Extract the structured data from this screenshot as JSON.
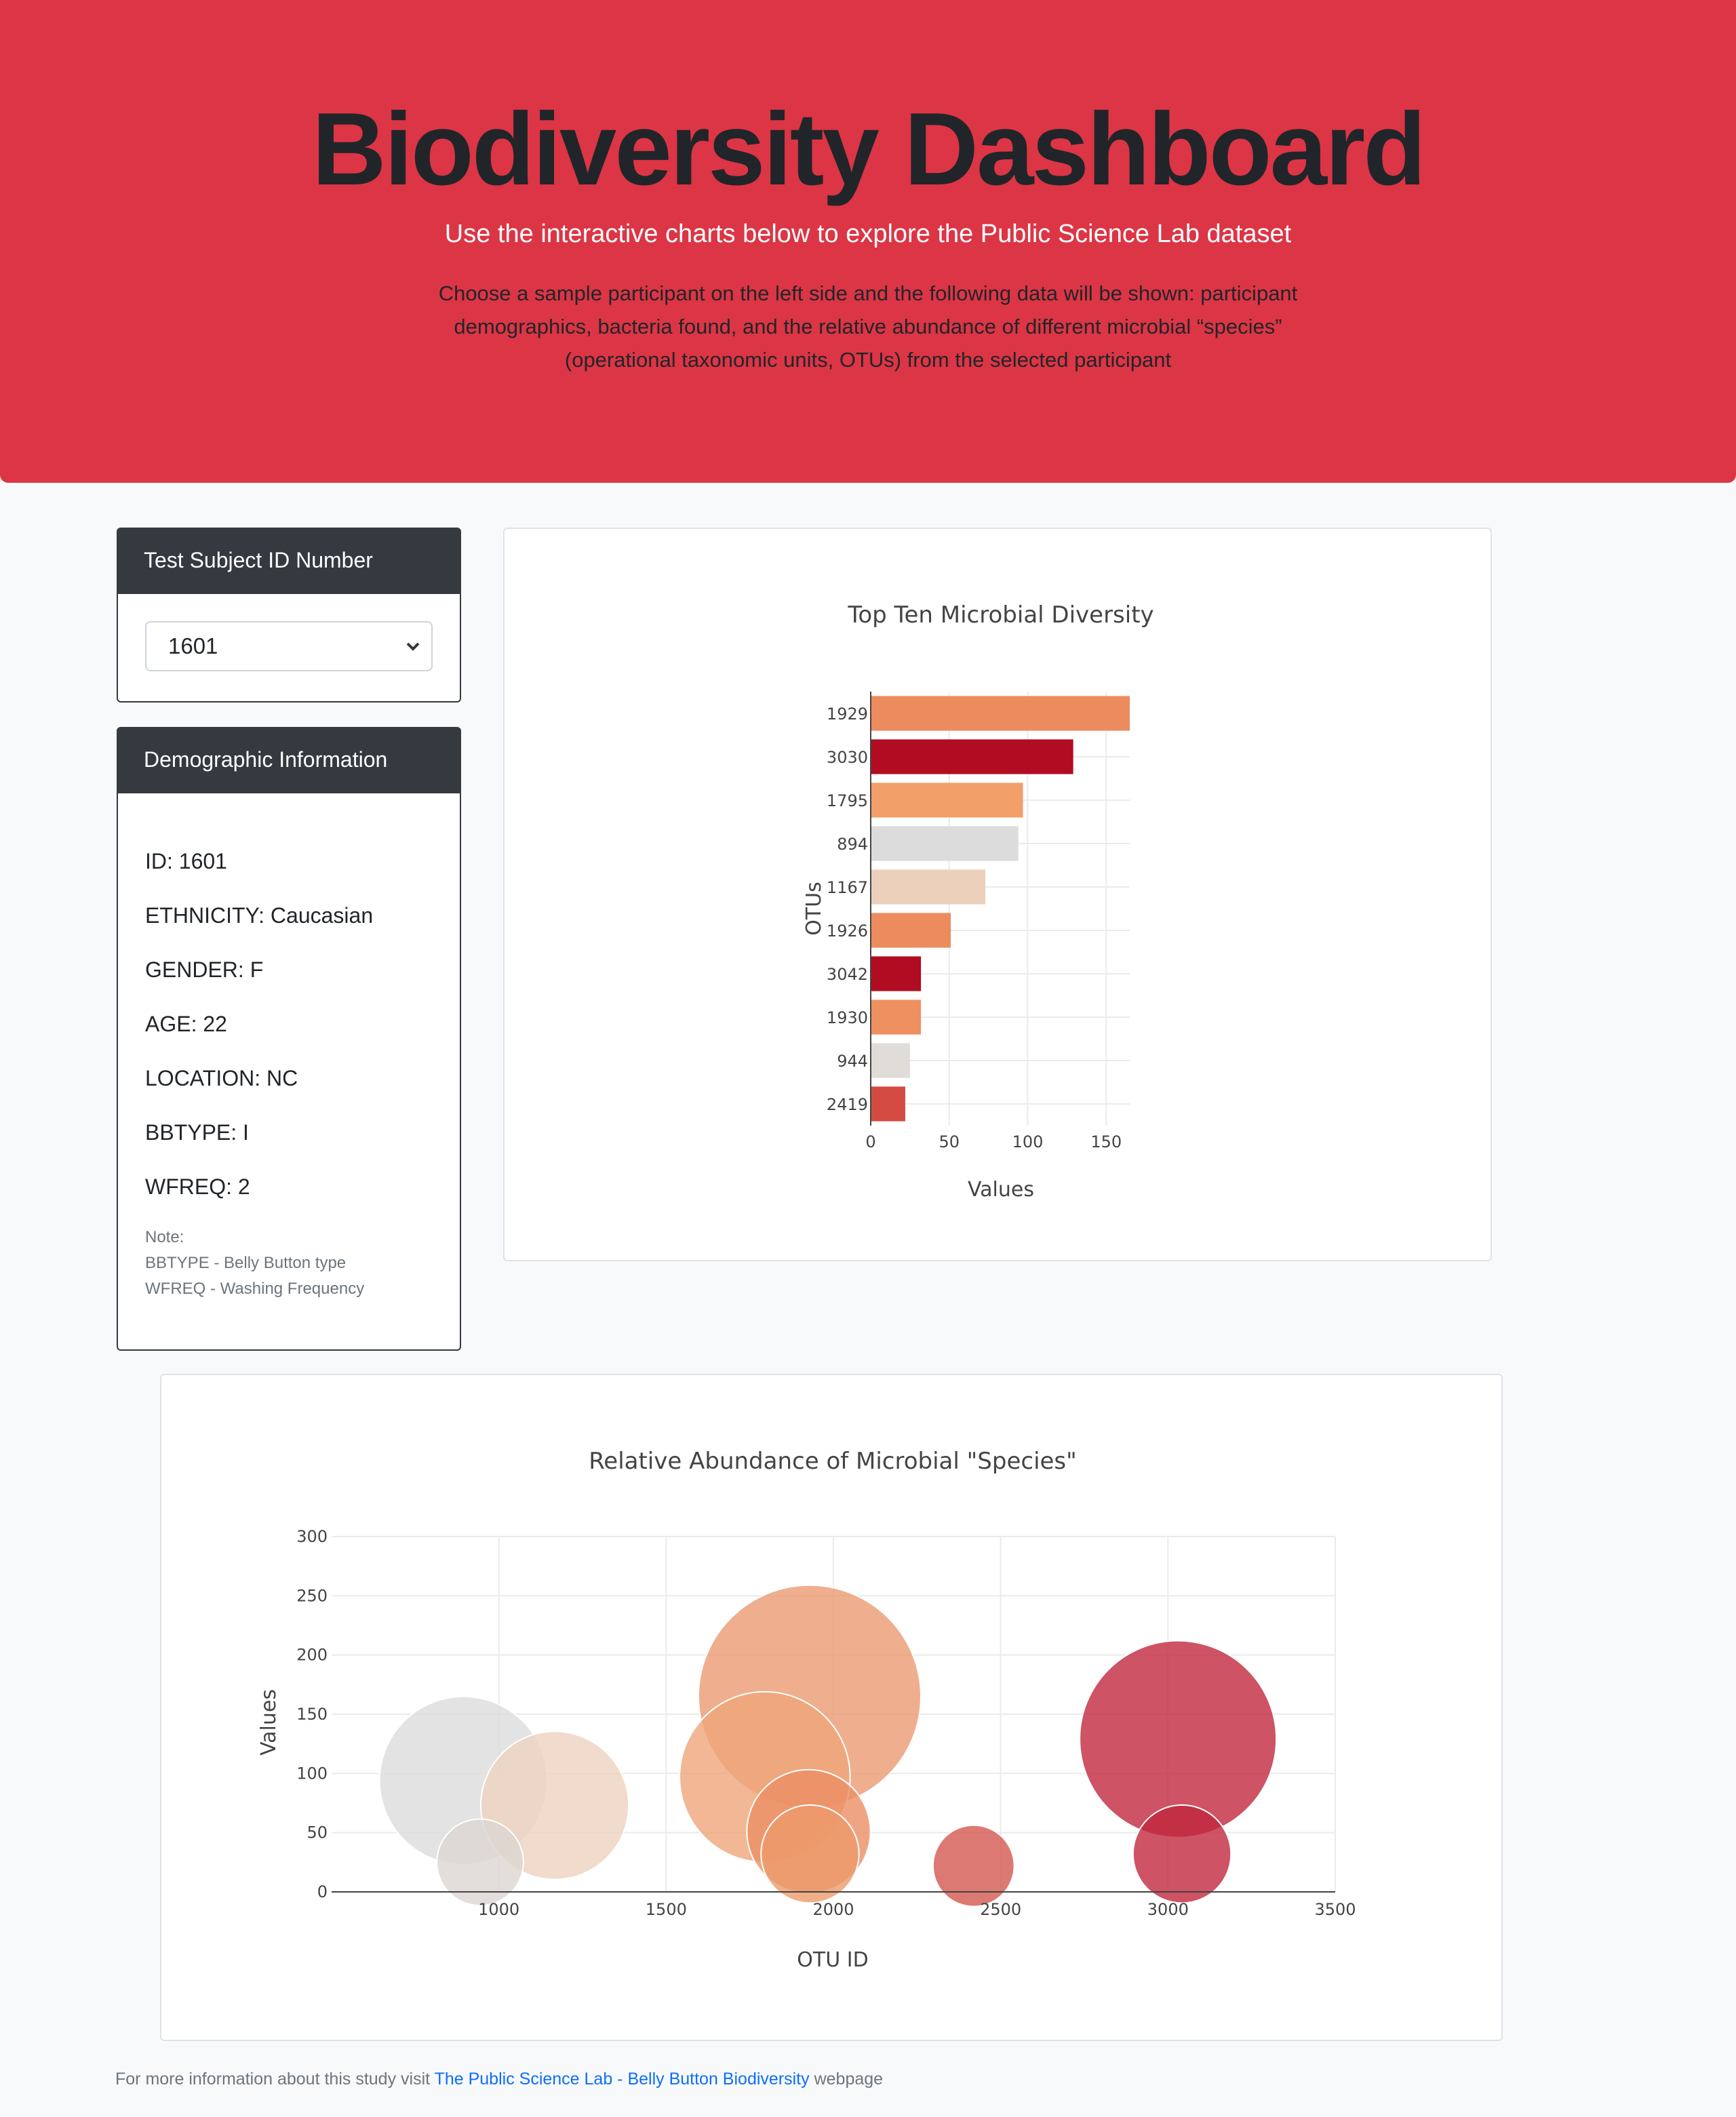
{
  "header": {
    "title": "Biodiversity Dashboard",
    "lead": "Use the interactive charts below to explore the Public Science Lab dataset",
    "description": "Choose a sample participant on the left side and the following data will be shown: participant demographics, bacteria found, and the relative abundance of different microbial “species” (operational taxonomic units, OTUs) from the selected participant"
  },
  "selector": {
    "heading": "Test Subject ID Number",
    "selected": "1601"
  },
  "demographics": {
    "heading": "Demographic Information",
    "lines": [
      "ID: 1601",
      "ETHNICITY: Caucasian",
      "GENDER: F",
      "AGE: 22",
      "LOCATION: NC",
      "BBTYPE: I",
      "WFREQ: 2"
    ],
    "note_title": "Note:",
    "note_1": "BBTYPE - Belly Button type",
    "note_2": "WFREQ - Washing Frequency"
  },
  "footer": {
    "prefix": "For more information about this study visit",
    "link_text": "The Public Science Lab - Belly Button Biodiversity",
    "suffix": "webpage"
  },
  "chart_data": [
    {
      "type": "bar",
      "orientation": "horizontal",
      "title": "Top Ten Microbial Diversity",
      "xlabel": "Values",
      "ylabel": "OTUs",
      "xlim": [
        0,
        165
      ],
      "xticks": [
        0,
        50,
        100,
        150
      ],
      "grid": true,
      "categories": [
        "1929",
        "3030",
        "1795",
        "894",
        "1167",
        "1926",
        "3042",
        "1930",
        "944",
        "2419"
      ],
      "values": [
        165,
        129,
        97,
        94,
        73,
        51,
        32,
        32,
        25,
        22
      ],
      "colors": [
        "#ec8c5e",
        "#b10c21",
        "#f29f6a",
        "#dcdcdc",
        "#ecd0bc",
        "#ec8c5e",
        "#b10c21",
        "#ef9060",
        "#e0dcd8",
        "#d34b40"
      ]
    },
    {
      "type": "scatter",
      "style": "bubble",
      "title": "Relative Abundance of Microbial \"Species\"",
      "xlabel": "OTU ID",
      "ylabel": "Values",
      "xlim": [
        500,
        3500
      ],
      "ylim": [
        0,
        300
      ],
      "xticks": [
        1000,
        1500,
        2000,
        2500,
        3000,
        3500
      ],
      "yticks": [
        0,
        50,
        100,
        150,
        200,
        250,
        300
      ],
      "grid": true,
      "points": [
        {
          "x": 1929,
          "y": 165,
          "color": "#eb9a70"
        },
        {
          "x": 3030,
          "y": 129,
          "color": "#c1283f"
        },
        {
          "x": 1795,
          "y": 97,
          "color": "#efa57a"
        },
        {
          "x": 894,
          "y": 94,
          "color": "#dcdcdc"
        },
        {
          "x": 1167,
          "y": 73,
          "color": "#ecd2bf"
        },
        {
          "x": 1926,
          "y": 51,
          "color": "#eb8e64"
        },
        {
          "x": 3042,
          "y": 32,
          "color": "#c1283f"
        },
        {
          "x": 1930,
          "y": 32,
          "color": "#ec9a6c"
        },
        {
          "x": 944,
          "y": 25,
          "color": "#dcd6d2"
        },
        {
          "x": 2419,
          "y": 22,
          "color": "#d45850"
        }
      ]
    }
  ]
}
